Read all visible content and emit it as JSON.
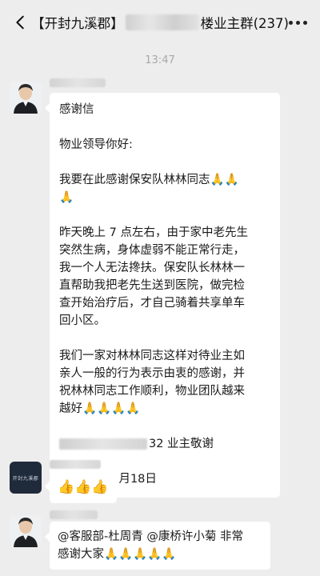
{
  "header": {
    "title_prefix": "【开封九溪郡】",
    "title_suffix": "楼业主群(237)",
    "back_icon": "chevron-left-icon",
    "more_icon": "more-dots-icon"
  },
  "timestamp": "13:47",
  "messages": [
    {
      "avatar": "person-avatar",
      "lines": {
        "heading": "感谢信",
        "greeting": "物业领导你好:",
        "p1_line1": "我要在此感谢保安队林林同志🙏🙏",
        "p1_line2": "🙏",
        "p2_line1": "昨天晚上 7 点左右，由于家中老先生",
        "p2_line2": "突然生病，身体虚弱不能正常行走，",
        "p2_line3": "我一个人无法搀扶。保安队长林林一",
        "p2_line4": "直帮助我把老先生送到医院，做完检",
        "p2_line5": "查开始治疗后，才自己骑着共享单车",
        "p2_line6": "回小区。",
        "p3_line1": "我们一家对林林同志这样对待业主如",
        "p3_line2": "亲人一般的行为表示由衷的感谢，并",
        "p3_line3": "祝林林同志工作顺利，物业团队越来",
        "p3_line4": "越好🙏🙏🙏🙏",
        "signature_suffix": "32 业主敬谢",
        "date": "2024 年 2 月18日"
      }
    },
    {
      "avatar": "jiuxijun-logo-avatar",
      "avatar_text": "开封九溪郡",
      "text": "👍👍👍"
    },
    {
      "avatar": "person-avatar",
      "line1": "@客服部-杜周青 @康桥许小菊 非常",
      "line2": "感谢大家🙏🙏🙏🙏🙏"
    }
  ]
}
